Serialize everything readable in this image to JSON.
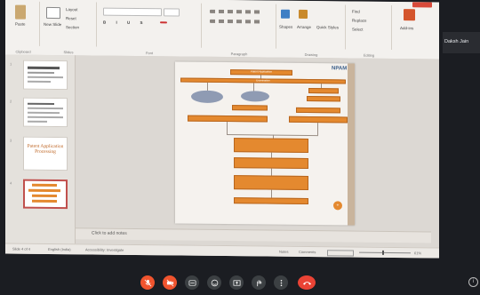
{
  "meeting": {
    "participant_name": "Daksh Jain",
    "info_icon": "info-icon"
  },
  "ribbon": {
    "clipboard": {
      "paste_label": "Paste",
      "group_label": "Clipboard"
    },
    "slides": {
      "new_slide_label": "New Slide",
      "layout_label": "Layout",
      "reset_label": "Reset",
      "section_label": "Section",
      "group_label": "Slides"
    },
    "font": {
      "group_label": "Font"
    },
    "paragraph": {
      "group_label": "Paragraph"
    },
    "drawing": {
      "shapes_label": "Shapes",
      "arrange_label": "Arrange",
      "quick_styles_label": "Quick Styles",
      "group_label": "Drawing"
    },
    "editing": {
      "find_label": "Find",
      "replace_label": "Replace",
      "select_label": "Select",
      "group_label": "Editing"
    },
    "addins": {
      "label": "Add-ins"
    }
  },
  "thumbnails": [
    {
      "number": "1"
    },
    {
      "number": "2"
    },
    {
      "number": "3",
      "title": "Patent Application Processing"
    },
    {
      "number": "4"
    }
  ],
  "slide": {
    "logo": "NPAM",
    "title_box": "Patent Application",
    "top_box": "Examination"
  },
  "notes": {
    "placeholder": "Click to add notes"
  },
  "statusbar": {
    "slide_info": "Slide 4 of 4",
    "language": "English (India)",
    "accessibility": "Accessibility: Investigate",
    "notes_label": "Notes",
    "comments_label": "Comments",
    "zoom": "61%"
  },
  "controls": [
    {
      "icon": "mic-off-icon"
    },
    {
      "icon": "camera-off-icon"
    },
    {
      "icon": "captions-icon"
    },
    {
      "icon": "emoji-icon"
    },
    {
      "icon": "present-icon"
    },
    {
      "icon": "raise-hand-icon"
    },
    {
      "icon": "more-options-icon"
    },
    {
      "icon": "leave-call-icon"
    }
  ]
}
